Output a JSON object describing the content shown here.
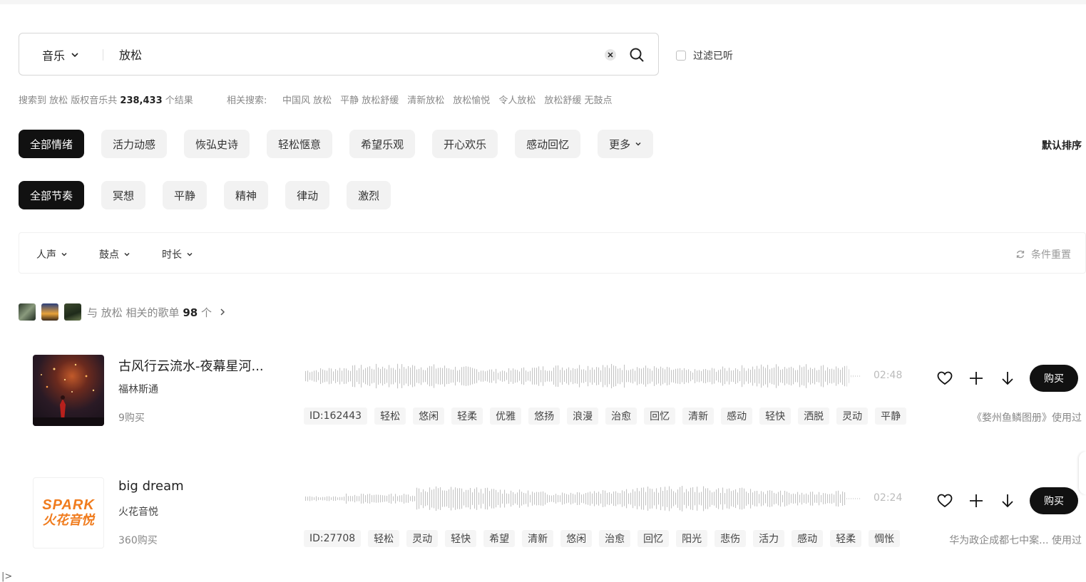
{
  "search": {
    "category": "音乐",
    "query": "放松",
    "filter_heard_label": "过滤已听"
  },
  "summary": {
    "prefix": "搜索到 放松 版权音乐共",
    "count": "238,433",
    "suffix": "个结果",
    "related_label": "相关搜索:",
    "related": [
      "中国风 放松",
      "平静 放松舒缓",
      "清新放松",
      "放松愉悦",
      "令人放松",
      "放松舒缓 无鼓点"
    ]
  },
  "moods": {
    "items": [
      "全部情绪",
      "活力动感",
      "恢弘史诗",
      "轻松惬意",
      "希望乐观",
      "开心欢乐",
      "感动回忆"
    ],
    "more_label": "更多",
    "sort_label": "默认排序"
  },
  "rhythms": {
    "items": [
      "全部节奏",
      "冥想",
      "平静",
      "精神",
      "律动",
      "激烈"
    ]
  },
  "filters": {
    "vocal": "人声",
    "drum": "鼓点",
    "duration": "时长",
    "reset": "条件重置"
  },
  "playlists": {
    "prefix": "与 放松 相关的歌单",
    "count": "98",
    "suffix": "个"
  },
  "tracks": [
    {
      "title": "古风行云流水-夜幕星河...",
      "artist": "福林斯通",
      "buys": "9购买",
      "duration": "02:48",
      "id_tag": "ID:162443",
      "tags": [
        "轻松",
        "悠闲",
        "轻柔",
        "优雅",
        "悠扬",
        "浪漫",
        "治愈",
        "回忆",
        "清新",
        "感动",
        "轻快",
        "洒脱",
        "灵动",
        "平静"
      ],
      "usage": "《婺州鱼鳞图册》使用过",
      "buy_label": "购买"
    },
    {
      "title": "big dream",
      "artist": "火花音悦",
      "buys": "360购买",
      "duration": "02:24",
      "id_tag": "ID:27708",
      "tags": [
        "轻松",
        "灵动",
        "轻快",
        "希望",
        "清新",
        "悠闲",
        "治愈",
        "回忆",
        "阳光",
        "悲伤",
        "活力",
        "感动",
        "轻柔",
        "惆怅"
      ],
      "usage": "华为政企成都七中案... 使用过",
      "buy_label": "购买",
      "cover_logo_line1": "SPARK",
      "cover_logo_line2": "火花音悦"
    }
  ],
  "corner_toggle": "|>",
  "colors": {
    "primary": "#111111",
    "chip_bg": "#f2f2f2",
    "muted": "#888888",
    "logo_orange": "#f07c1e"
  }
}
